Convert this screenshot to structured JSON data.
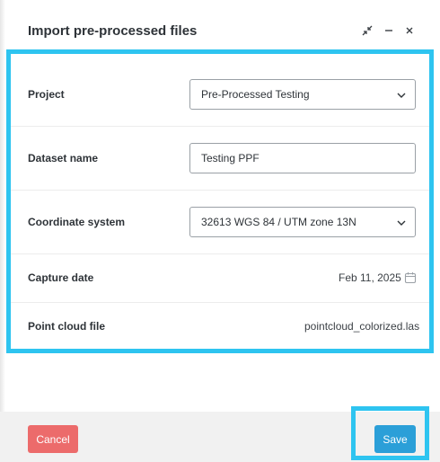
{
  "dialog": {
    "title": "Import pre-processed files",
    "header_icons": [
      "collapse-icon",
      "minimize-icon",
      "close-icon"
    ]
  },
  "form": {
    "project": {
      "label": "Project",
      "value": "Pre-Processed Testing"
    },
    "dataset_name": {
      "label": "Dataset name",
      "value": "Testing PPF"
    },
    "coordinate_system": {
      "label": "Coordinate system",
      "value": "32613 WGS 84 / UTM zone 13N"
    },
    "capture_date": {
      "label": "Capture date",
      "value": "Feb 11, 2025"
    },
    "point_cloud_file": {
      "label": "Point cloud file",
      "value": "pointcloud_colorized.las"
    }
  },
  "footer": {
    "cancel_label": "Cancel",
    "save_label": "Save"
  },
  "colors": {
    "highlight": "#2ec4f0",
    "cancel": "#ec6b6b",
    "save": "#2b9fd8"
  }
}
